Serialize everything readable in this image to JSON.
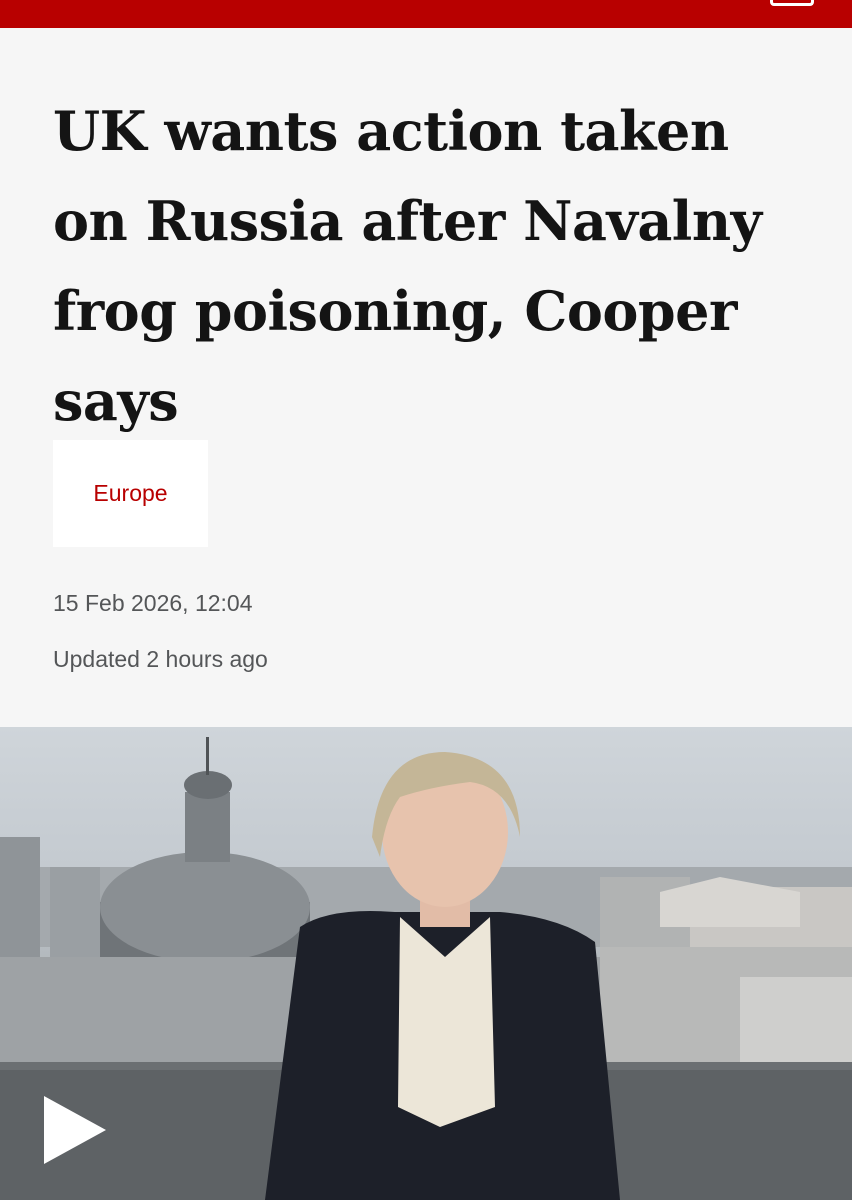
{
  "header": {
    "menu_icon": "menu-icon",
    "brand_color": "#b80000"
  },
  "article": {
    "headline": "UK wants action taken on Russia after Navalny frog poisoning, Cooper says",
    "topic": "Europe",
    "published": "15 Feb 2026, 12:04",
    "updated": "Updated 2 hours ago"
  },
  "media": {
    "play_icon": "play-icon"
  }
}
